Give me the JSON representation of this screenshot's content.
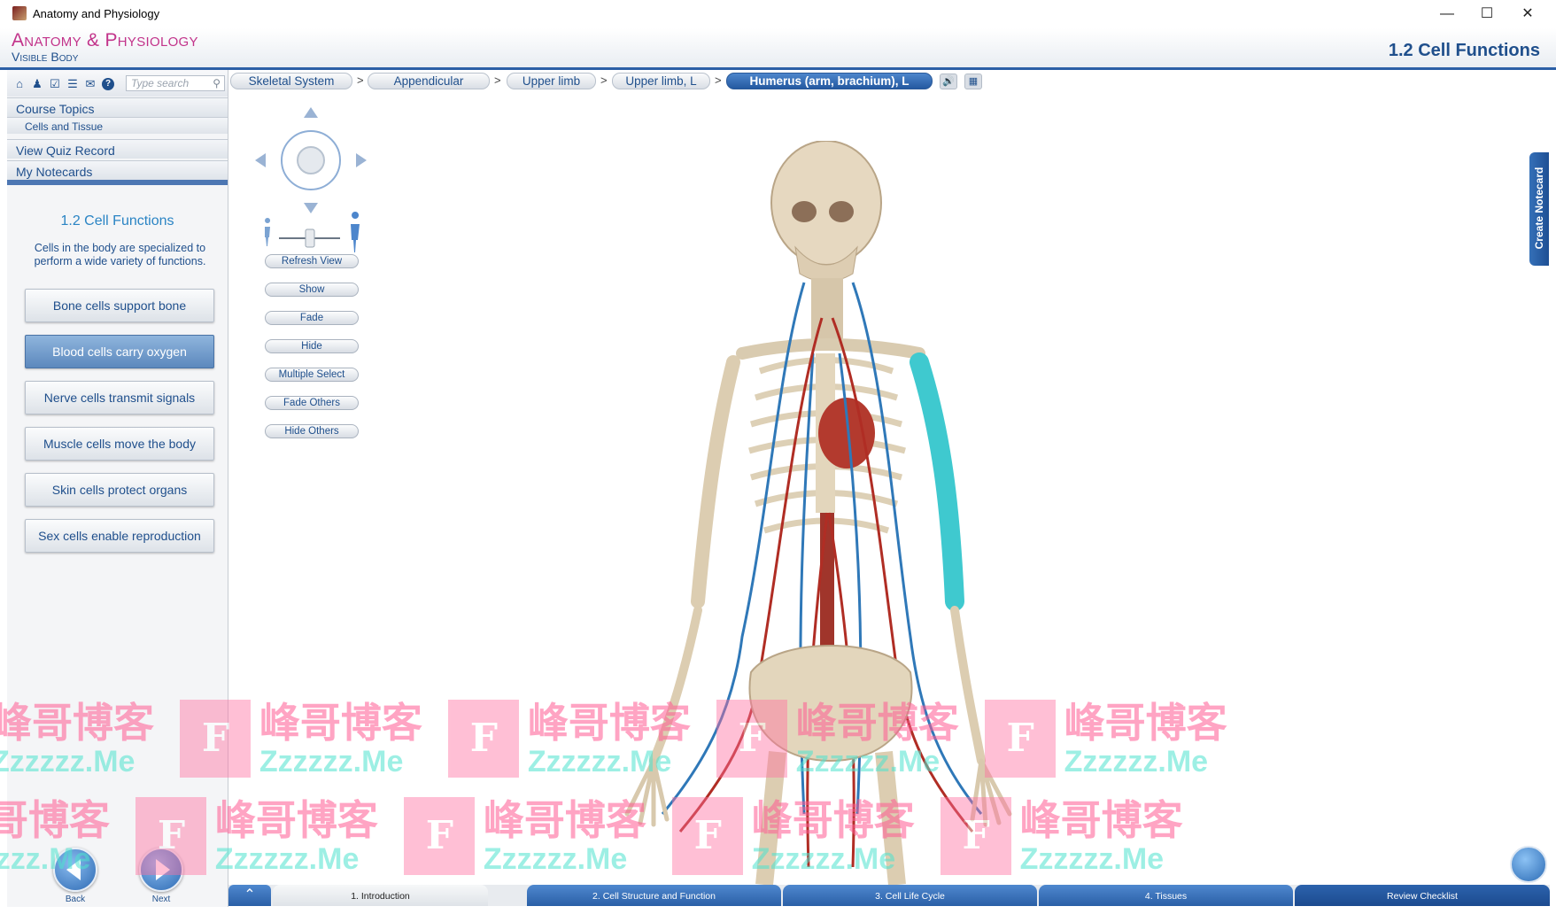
{
  "window": {
    "title": "Anatomy and Physiology"
  },
  "header": {
    "logo_line1": "Anatomy & Physiology",
    "logo_line2": "Visible Body",
    "page_heading": "1.2 Cell Functions"
  },
  "sidebar": {
    "search_placeholder": "Type search",
    "nav": {
      "course_topics": "Course Topics",
      "cells_and_tissue": "Cells and Tissue",
      "view_quiz_record": "View Quiz Record",
      "my_notecards": "My Notecards"
    },
    "lesson_title": "1.2 Cell Functions",
    "lesson_description": "Cells in the body are specialized to perform a wide variety of functions.",
    "topics": [
      {
        "label": "Bone cells support bone",
        "active": false
      },
      {
        "label": "Blood cells carry oxygen",
        "active": true
      },
      {
        "label": "Nerve cells transmit signals",
        "active": false
      },
      {
        "label": "Muscle cells move the body",
        "active": false
      },
      {
        "label": "Skin cells protect organs",
        "active": false
      },
      {
        "label": "Sex cells enable reproduction",
        "active": false
      }
    ],
    "back_label": "Back",
    "next_label": "Next"
  },
  "breadcrumb": {
    "items": [
      "Skeletal System",
      "Appendicular",
      "Upper limb",
      "Upper limb, L",
      "Humerus (arm, brachium), L"
    ],
    "separator": ">"
  },
  "controls": {
    "buttons": [
      "Refresh View",
      "Show",
      "Fade",
      "Hide",
      "Multiple Select",
      "Fade Others",
      "Hide Others"
    ]
  },
  "notecard_tab": "Create Notecard",
  "bottom_tabs": [
    {
      "label": "1. Introduction",
      "active": true
    },
    {
      "label": "2. Cell Structure and Function",
      "active": false
    },
    {
      "label": "3. Cell Life Cycle",
      "active": false
    },
    {
      "label": "4. Tissues",
      "active": false
    },
    {
      "label": "Review Checklist",
      "active": false
    }
  ],
  "watermark": {
    "cn": "峰哥博客",
    "en": "Zzzzzz.Me",
    "letter": "F"
  },
  "colors": {
    "brand_blue": "#1f4f8c",
    "brand_pink": "#c2338a",
    "accent_cyan": "#2a84c4"
  }
}
